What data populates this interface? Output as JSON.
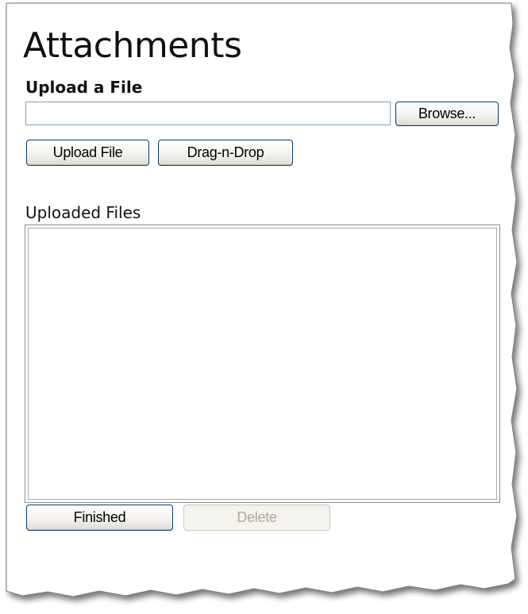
{
  "attachments": {
    "title": "Attachments",
    "upload_heading": "Upload a File",
    "file_input": {
      "value": "",
      "placeholder": ""
    },
    "browse_label": "Browse...",
    "upload_file_label": "Upload File",
    "drag_drop_label": "Drag-n-Drop",
    "uploaded_files_label": "Uploaded Files",
    "uploaded_files": [],
    "finished_label": "Finished",
    "delete_label": "Delete"
  },
  "colors": {
    "button_border": "#003c74",
    "input_border": "#7f9db9",
    "disabled_text": "#aca899"
  }
}
